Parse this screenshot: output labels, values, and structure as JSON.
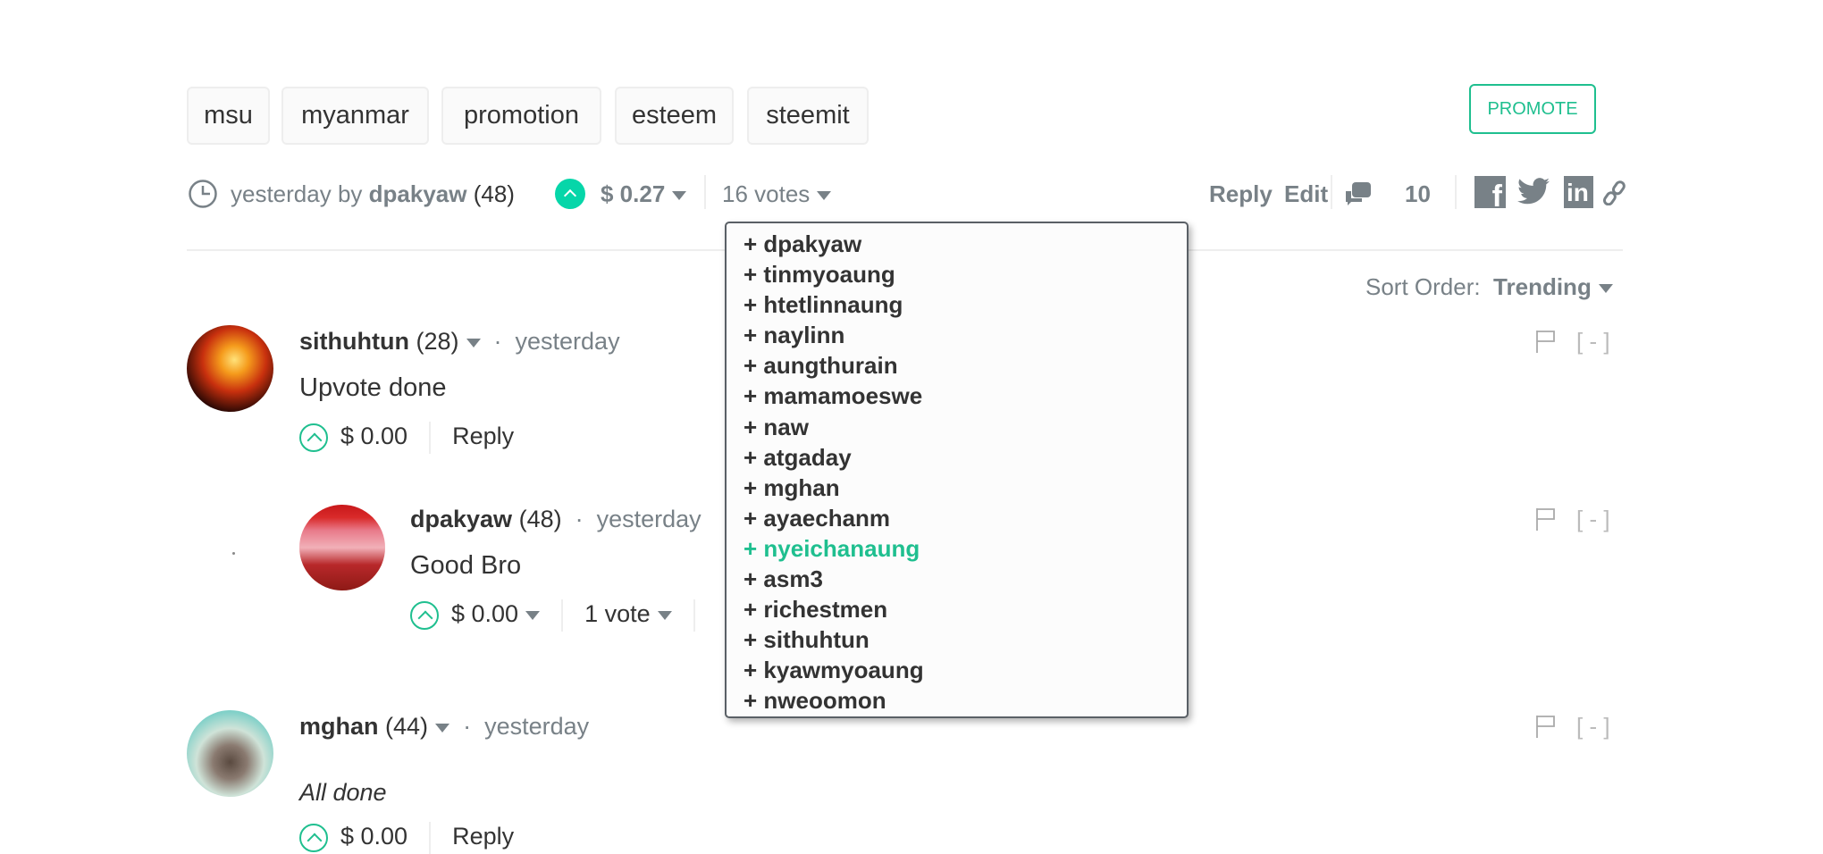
{
  "tags": [
    "msu",
    "myanmar",
    "promotion",
    "esteem",
    "steemit"
  ],
  "promote_label": "PROMOTE",
  "post_meta": {
    "time": "yesterday by",
    "author": "dpakyaw",
    "reputation": "(48)",
    "payout": "$ 0.27",
    "votes": "16 votes",
    "reply": "Reply",
    "edit": "Edit",
    "comment_count": "10"
  },
  "social_icons": [
    "facebook-icon",
    "twitter-icon",
    "linkedin-icon",
    "link-icon"
  ],
  "voters": [
    "+ dpakyaw",
    "+ tinmyoaung",
    "+ htetlinnaung",
    "+ naylinn",
    "+ aungthurain",
    "+ mamamoeswe",
    "+ naw",
    "+ atgaday",
    "+ mghan",
    "+ ayaechanm",
    "+ nyeichanaung",
    "+ asm3",
    "+ richestmen",
    "+ sithuhtun",
    "+ kyawmyoaung",
    "+ nweoomon"
  ],
  "highlighted_voter": "+ nyeichanaung",
  "sort": {
    "label": "Sort Order:",
    "value": "Trending"
  },
  "comments": [
    {
      "author": "sithuhtun",
      "reputation": "(28)",
      "time": "yesterday",
      "body": "Upvote done",
      "payout": "$ 0.00",
      "reply": "Reply"
    },
    {
      "author": "dpakyaw",
      "reputation": "(48)",
      "time": "yesterday",
      "body": "Good Bro",
      "payout": "$ 0.00",
      "votes": "1 vote"
    },
    {
      "author": "mghan",
      "reputation": "(44)",
      "time": "yesterday",
      "body": "All done",
      "payout": "$ 0.00",
      "reply": "Reply"
    }
  ],
  "collapse_label": "[ - ]",
  "colors": {
    "accent": "#1fbf8f",
    "muted": "#788187",
    "text": "#333333"
  }
}
